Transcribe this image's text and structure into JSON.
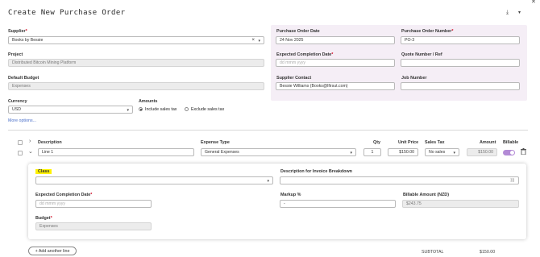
{
  "page": {
    "title": "Create New Purchase Order"
  },
  "top_icons": {
    "download": "⤓",
    "dropdown": "▾",
    "close": "✕"
  },
  "supplier": {
    "label": "Supplier",
    "value": "Books by Bessie",
    "clear": "×",
    "caret": "▾"
  },
  "project": {
    "label": "Project",
    "value": "Distributed Bitcoin Mining Platform"
  },
  "default_budget": {
    "label": "Default Budget",
    "value": "Expenses"
  },
  "currency": {
    "label": "Currency",
    "value": "USD",
    "caret": "▾"
  },
  "amounts": {
    "label": "Amounts",
    "include": "Include sales tax",
    "exclude": "Exclude sales tax",
    "selected": "include"
  },
  "more_options": "More options...",
  "po_date": {
    "label": "Purchase Order Date",
    "value": "24 Nov 2025"
  },
  "po_number": {
    "label": "Purchase Order Number",
    "value": "PO-3"
  },
  "expected_completion": {
    "label": "Expected Completion Date",
    "placeholder": "dd mmm yyyy"
  },
  "quote_number": {
    "label": "Quote Number / Ref",
    "value": ""
  },
  "supplier_contact": {
    "label": "Supplier Contact",
    "value": "Bessie Williams (Books@lfirsut.com)"
  },
  "job_number": {
    "label": "Job Number",
    "value": ""
  },
  "table": {
    "headers": {
      "description": "Description",
      "expense_type": "Expense Type",
      "qty": "Qty",
      "unit_price": "Unit Price",
      "sales_tax": "Sales Tax",
      "amount": "Amount",
      "billable": "Billable"
    },
    "row": {
      "description": "Line 1",
      "expense_type": "General Expenses",
      "qty": "1",
      "unit_price": "$150.00",
      "sales_tax": "No sales",
      "amount": "$150.00",
      "billable": true
    }
  },
  "detail": {
    "class_label": "Class",
    "class_value": "",
    "invoice_desc_label": "Description for Invoice Breakdown",
    "invoice_desc_value": "",
    "expected_completion_label": "Expected Completion Date",
    "expected_completion_placeholder": "dd mmm yyyy",
    "markup_label": "Markup %",
    "markup_value": "-",
    "billable_amount_label": "Billable Amount (NZD)",
    "billable_amount_value": "$243.75",
    "budget_label": "Budget",
    "budget_value": "Expenses"
  },
  "add_line": "+ Add another line",
  "subtotal": {
    "label": "SUBTOTAL",
    "value": "$150.00"
  },
  "colors": {
    "panel": "#f5eef6",
    "toggle": "#b38bd6",
    "link": "#4a6fc9",
    "highlight": "#fff200"
  }
}
